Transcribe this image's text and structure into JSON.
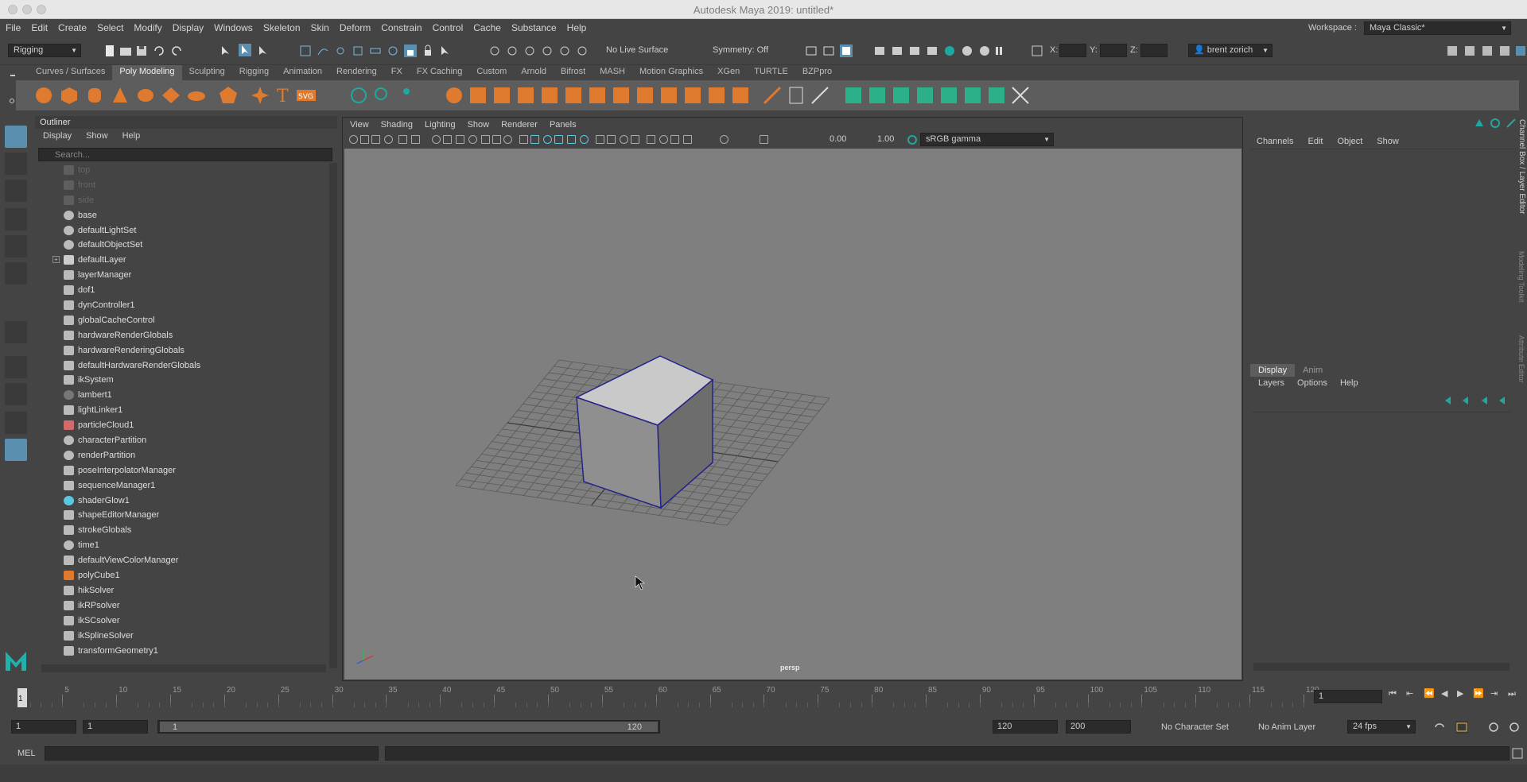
{
  "window": {
    "title": "Autodesk Maya 2019: untitled*"
  },
  "menu": [
    "File",
    "Edit",
    "Create",
    "Select",
    "Modify",
    "Display",
    "Windows",
    "Skeleton",
    "Skin",
    "Deform",
    "Constrain",
    "Control",
    "Cache",
    "Substance",
    "Help"
  ],
  "workspace": {
    "label": "Workspace :",
    "value": "Maya Classic*"
  },
  "statusline": {
    "mode": "Rigging",
    "live_surface": "No Live Surface",
    "symmetry": "Symmetry: Off",
    "x_label": "X:",
    "y_label": "Y:",
    "z_label": "Z:",
    "user": "brent zorich"
  },
  "shelf_tabs": [
    "Curves / Surfaces",
    "Poly Modeling",
    "Sculpting",
    "Rigging",
    "Animation",
    "Rendering",
    "FX",
    "FX Caching",
    "Custom",
    "Arnold",
    "Bifrost",
    "MASH",
    "Motion Graphics",
    "XGen",
    "TURTLE",
    "BZPpro"
  ],
  "shelf_active": "Poly Modeling",
  "outliner": {
    "title": "Outliner",
    "menu": [
      "Display",
      "Show",
      "Help"
    ],
    "search_placeholder": "Search...",
    "items": [
      {
        "label": "top",
        "dim": true,
        "icon": "camera-icon"
      },
      {
        "label": "front",
        "dim": true,
        "icon": "camera-icon"
      },
      {
        "label": "side",
        "dim": true,
        "icon": "camera-icon"
      },
      {
        "label": "base",
        "icon": "set-icon"
      },
      {
        "label": "defaultLightSet",
        "icon": "set-icon"
      },
      {
        "label": "defaultObjectSet",
        "icon": "set-icon"
      },
      {
        "label": "defaultLayer",
        "icon": "layer-icon",
        "expand": true
      },
      {
        "label": "layerManager",
        "icon": "node-icon"
      },
      {
        "label": "dof1",
        "icon": "node-icon"
      },
      {
        "label": "dynController1",
        "icon": "node-icon"
      },
      {
        "label": "globalCacheControl",
        "icon": "node-icon"
      },
      {
        "label": "hardwareRenderGlobals",
        "icon": "node-icon"
      },
      {
        "label": "hardwareRenderingGlobals",
        "icon": "node-icon"
      },
      {
        "label": "defaultHardwareRenderGlobals",
        "icon": "node-icon"
      },
      {
        "label": "ikSystem",
        "icon": "node-icon"
      },
      {
        "label": "lambert1",
        "icon": "material-icon"
      },
      {
        "label": "lightLinker1",
        "icon": "link-icon"
      },
      {
        "label": "particleCloud1",
        "icon": "particle-icon"
      },
      {
        "label": "characterPartition",
        "icon": "partition-icon"
      },
      {
        "label": "renderPartition",
        "icon": "partition-icon"
      },
      {
        "label": "poseInterpolatorManager",
        "icon": "node-icon"
      },
      {
        "label": "sequenceManager1",
        "icon": "node-icon"
      },
      {
        "label": "shaderGlow1",
        "icon": "glow-icon"
      },
      {
        "label": "shapeEditorManager",
        "icon": "node-icon"
      },
      {
        "label": "strokeGlobals",
        "icon": "node-icon"
      },
      {
        "label": "time1",
        "icon": "clock-icon"
      },
      {
        "label": "defaultViewColorManager",
        "icon": "node-icon"
      },
      {
        "label": "polyCube1",
        "icon": "cube-icon"
      },
      {
        "label": "hikSolver",
        "icon": "node-icon"
      },
      {
        "label": "ikRPsolver",
        "icon": "solver-icon"
      },
      {
        "label": "ikSCsolver",
        "icon": "solver-icon"
      },
      {
        "label": "ikSplineSolver",
        "icon": "solver-icon"
      },
      {
        "label": "transformGeometry1",
        "icon": "node-icon"
      }
    ]
  },
  "viewport": {
    "menu": [
      "View",
      "Shading",
      "Lighting",
      "Show",
      "Renderer",
      "Panels"
    ],
    "exposure": "0.00",
    "gamma": "1.00",
    "colorspace": "sRGB gamma",
    "camera_label": "persp"
  },
  "channelbox": {
    "menu": [
      "Channels",
      "Edit",
      "Object",
      "Show"
    ],
    "side_tab": "Channel Box / Layer Editor",
    "side_tabs_extra": [
      "Modeling Toolkit",
      "Attribute Editor"
    ]
  },
  "layers": {
    "tabs": [
      "Display",
      "Anim"
    ],
    "menu": [
      "Layers",
      "Options",
      "Help"
    ]
  },
  "timeline": {
    "ticks": [
      "1",
      "5",
      "10",
      "15",
      "20",
      "25",
      "30",
      "35",
      "40",
      "45",
      "50",
      "55",
      "60",
      "65",
      "70",
      "75",
      "80",
      "85",
      "90",
      "95",
      "100",
      "105",
      "110",
      "115",
      "120"
    ],
    "current_frame": "1"
  },
  "range": {
    "start": "1",
    "playback_start": "1",
    "slider_start": "1",
    "slider_end": "120",
    "playback_end": "120",
    "end": "200",
    "character_set": "No Character Set",
    "anim_layer": "No Anim Layer",
    "fps": "24 fps"
  },
  "commandline": {
    "label": "MEL"
  }
}
